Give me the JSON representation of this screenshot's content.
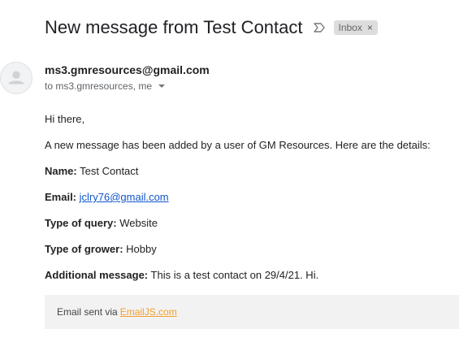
{
  "email": {
    "subject": "New message from Test Contact",
    "label": "Inbox",
    "label_remove": "×",
    "sender": "ms3.gmresources@gmail.com",
    "recipients": "to ms3.gmresources, me"
  },
  "message": {
    "greeting": "Hi there,",
    "intro": "A new message has been added by a user of GM Resources. Here are the details:",
    "fields": [
      {
        "label": "Name:",
        "value": "Test Contact"
      },
      {
        "label": "Email:",
        "value": "jclry76@gmail.com"
      },
      {
        "label": "Type of query:",
        "value": "Website"
      },
      {
        "label": "Type of grower:",
        "value": "Hobby"
      },
      {
        "label": "Additional message:",
        "value": "This is a test contact on 29/4/21. Hi."
      }
    ]
  },
  "footer": {
    "prefix": "Email sent via",
    "link": "EmailJS.com"
  },
  "icons": {
    "important": "important-marker-icon",
    "avatar": "default-avatar-icon",
    "caret": "chevron-down-icon"
  },
  "colors": {
    "link": "#1155cc",
    "footer_link": "#f0a030",
    "chip_bg": "#dddddd"
  }
}
